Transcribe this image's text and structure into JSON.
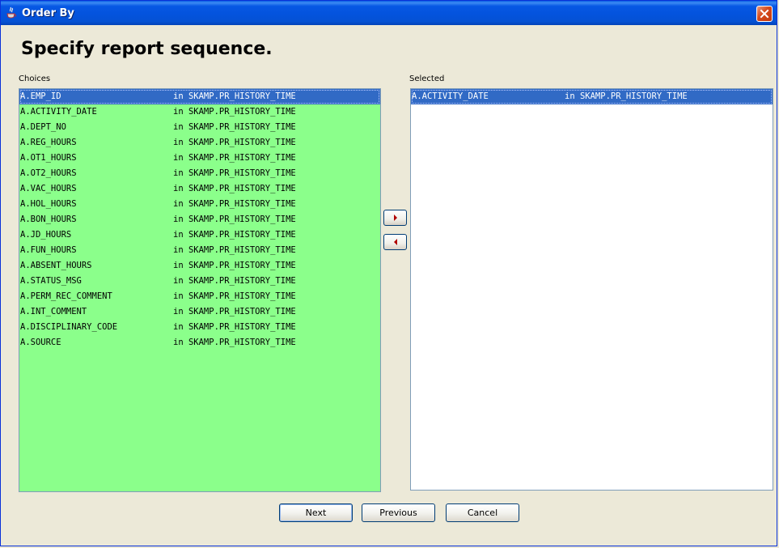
{
  "window": {
    "title": "Order By"
  },
  "heading": "Specify report sequence.",
  "choices": {
    "label": "Choices",
    "items": [
      {
        "field": "A.EMP_ID",
        "source": "in SKAMP.PR_HISTORY_TIME"
      },
      {
        "field": "A.ACTIVITY_DATE",
        "source": "in SKAMP.PR_HISTORY_TIME"
      },
      {
        "field": "A.DEPT_NO",
        "source": "in SKAMP.PR_HISTORY_TIME"
      },
      {
        "field": "A.REG_HOURS",
        "source": "in SKAMP.PR_HISTORY_TIME"
      },
      {
        "field": "A.OT1_HOURS",
        "source": "in SKAMP.PR_HISTORY_TIME"
      },
      {
        "field": "A.OT2_HOURS",
        "source": "in SKAMP.PR_HISTORY_TIME"
      },
      {
        "field": "A.VAC_HOURS",
        "source": "in SKAMP.PR_HISTORY_TIME"
      },
      {
        "field": "A.HOL_HOURS",
        "source": "in SKAMP.PR_HISTORY_TIME"
      },
      {
        "field": "A.BON_HOURS",
        "source": "in SKAMP.PR_HISTORY_TIME"
      },
      {
        "field": "A.JD_HOURS",
        "source": "in SKAMP.PR_HISTORY_TIME"
      },
      {
        "field": "A.FUN_HOURS",
        "source": "in SKAMP.PR_HISTORY_TIME"
      },
      {
        "field": "A.ABSENT_HOURS",
        "source": "in SKAMP.PR_HISTORY_TIME"
      },
      {
        "field": "A.STATUS_MSG",
        "source": "in SKAMP.PR_HISTORY_TIME"
      },
      {
        "field": "A.PERM_REC_COMMENT",
        "source": "in SKAMP.PR_HISTORY_TIME"
      },
      {
        "field": "A.INT_COMMENT",
        "source": "in SKAMP.PR_HISTORY_TIME"
      },
      {
        "field": "A.DISCIPLINARY_CODE",
        "source": "in SKAMP.PR_HISTORY_TIME"
      },
      {
        "field": "A.SOURCE",
        "source": "in SKAMP.PR_HISTORY_TIME"
      }
    ],
    "selected_index": 0
  },
  "selected": {
    "label": "Selected",
    "items": [
      {
        "field": "A.ACTIVITY_DATE",
        "source": "in SKAMP.PR_HISTORY_TIME"
      }
    ],
    "selected_index": 0
  },
  "buttons": {
    "add_icon": "triangle-right-icon",
    "remove_icon": "triangle-left-icon",
    "next": "Next",
    "previous": "Previous",
    "cancel": "Cancel"
  },
  "colors": {
    "choices_bg": "#8bff8b",
    "selection": "#316ac5",
    "titlebar": "#0453dd",
    "arrow": "#b00000"
  }
}
